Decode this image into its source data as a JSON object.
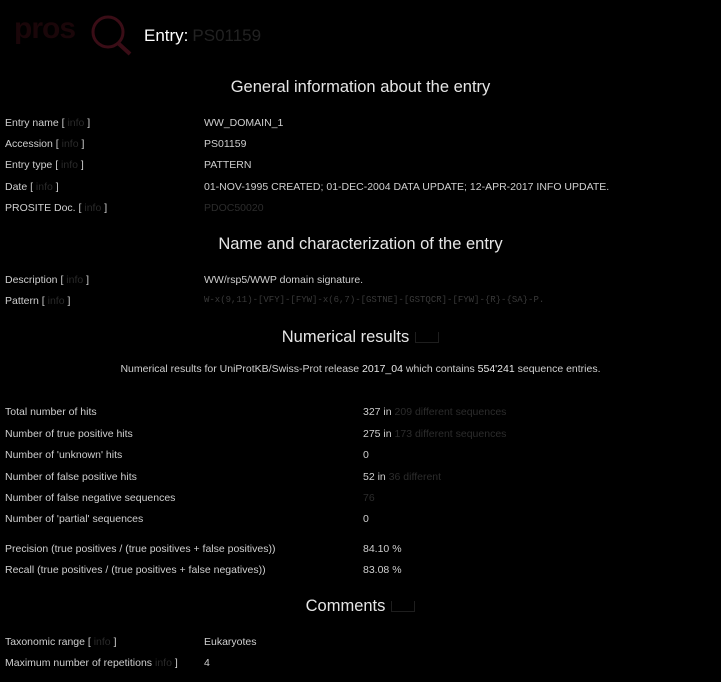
{
  "header": {
    "logo_text": "PROSITE",
    "entry_label": "Entry:",
    "accession": "PS01159"
  },
  "general": {
    "heading": "General information about the entry",
    "rows": [
      {
        "label": "Entry name [",
        "help": "info",
        "value": "WW_DOMAIN_1"
      },
      {
        "label": "Accession [",
        "help": "info",
        "value": "PS01159"
      },
      {
        "label": "Entry type [",
        "help": "info",
        "value": "PATTERN"
      },
      {
        "label": "Date [",
        "help": "info",
        "value": "01-NOV-1995 CREATED; 01-DEC-2004 DATA UPDATE; 12-APR-2017 INFO UPDATE."
      },
      {
        "label": "PROSITE Doc. [",
        "help": "info",
        "value": "PDOC50020"
      }
    ]
  },
  "characterization": {
    "heading": "Name and characterization of the entry",
    "rows": [
      {
        "label": "Description [",
        "help": "info",
        "value": "WW/rsp5/WWP domain signature."
      },
      {
        "label": "Pattern [",
        "help": "info",
        "value": "W-x(9,11)-[VFY]-[FYW]-x(6,7)-[GSTNE]-[GSTQCR]-[FYW]-{R}-{SA}-P."
      }
    ]
  },
  "numerical": {
    "heading": "Numerical results",
    "summary_prefix": "Numerical results for UniProtKB/Swiss-Prot release",
    "release": "2017_04",
    "summary_mid": "which contains",
    "entries": "554'241",
    "summary_suffix": "sequence entries.",
    "rows": [
      {
        "label": "Total number of hits",
        "value": "327 in",
        "extra": "209 different sequences"
      },
      {
        "label": "Number of true positive hits",
        "value": "275 in",
        "extra": "173 different sequences"
      },
      {
        "label": "Number of 'unknown' hits",
        "value": "0",
        "extra": ""
      },
      {
        "label": "Number of false positive hits",
        "value": "52 in",
        "extra": "36 different"
      },
      {
        "label": "Number of false negative sequences",
        "value": "",
        "extra": "76"
      },
      {
        "label": "Number of 'partial' sequences",
        "value": "0",
        "extra": ""
      },
      {
        "label": "Precision (true positives / (true positives + false positives))",
        "value": "84.10 %",
        "extra": ""
      },
      {
        "label": "Recall (true positives / (true positives + false negatives))",
        "value": "83.08 %",
        "extra": ""
      }
    ]
  },
  "comments": {
    "heading": "Comments",
    "rows": [
      {
        "label": "Taxonomic range [",
        "help": "info",
        "value": "Eukaryotes"
      },
      {
        "label": "Maximum number of repetitions",
        "help": "info",
        "value": "4"
      }
    ]
  }
}
